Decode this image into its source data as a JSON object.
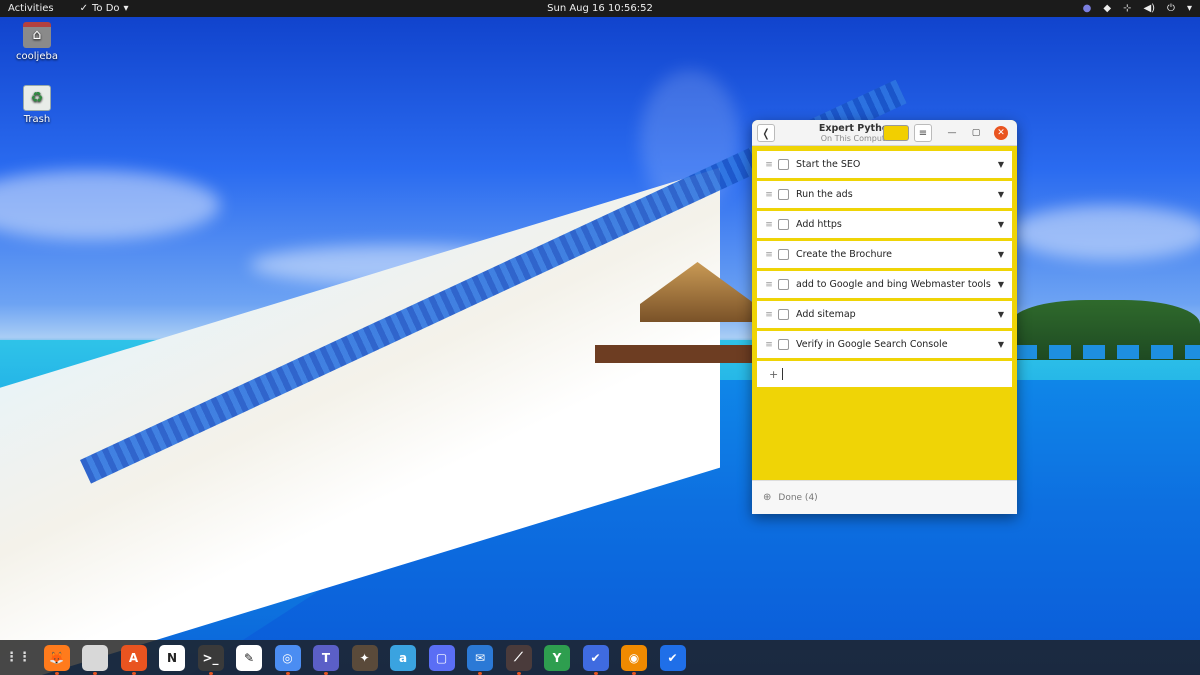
{
  "topbar": {
    "activities": "Activities",
    "app_name": "To Do",
    "clock": "Sun Aug 16  10:56:52"
  },
  "desktop": {
    "home_label": "cooljeba",
    "trash_label": "Trash"
  },
  "todo_window": {
    "title": "Expert Python",
    "subtitle": "On This Computer",
    "list_color": "#f2cf00",
    "background_color": "#efd406",
    "tasks": [
      {
        "label": "Start the SEO"
      },
      {
        "label": "Run the ads"
      },
      {
        "label": "Add https"
      },
      {
        "label": "Create the Brochure"
      },
      {
        "label": "add to Google and bing Webmaster tools"
      },
      {
        "label": "Add sitemap"
      },
      {
        "label": "Verify in Google Search Console"
      }
    ],
    "new_task_prefix": "+",
    "done_label": "Done (4)"
  },
  "dock": {
    "apps": [
      {
        "name": "apps-grid-icon",
        "glyph": "⋮⋮"
      },
      {
        "name": "firefox-icon",
        "glyph": "🦊",
        "color": "#ff7b1c"
      },
      {
        "name": "files-icon",
        "glyph": "",
        "color": "#d8d8d8"
      },
      {
        "name": "software-icon",
        "glyph": "A",
        "color": "#e95420"
      },
      {
        "name": "notion-icon",
        "glyph": "N",
        "color": "#ffffff"
      },
      {
        "name": "terminal-icon",
        "glyph": ">_",
        "color": "#3a3a3a"
      },
      {
        "name": "text-editor-icon",
        "glyph": "✎",
        "color": "#ffffff"
      },
      {
        "name": "chromium-icon",
        "glyph": "◎",
        "color": "#4b8df2"
      },
      {
        "name": "teams-icon",
        "glyph": "T",
        "color": "#5b5fc7"
      },
      {
        "name": "gimp-icon",
        "glyph": "✦",
        "color": "#5a4a3a"
      },
      {
        "name": "amazon-icon",
        "glyph": "a",
        "color": "#3aa3e0"
      },
      {
        "name": "screenshot-icon",
        "glyph": "▢",
        "color": "#5a6ef5"
      },
      {
        "name": "mail-icon",
        "glyph": "✉",
        "color": "#2b79d6"
      },
      {
        "name": "color-picker-icon",
        "glyph": "⟋",
        "color": "#4a3b3b"
      },
      {
        "name": "inkscape-icon",
        "glyph": "Y",
        "color": "#2e9e4f"
      },
      {
        "name": "todo-icon",
        "glyph": "✔",
        "color": "#3f6be0"
      },
      {
        "name": "podcast-icon",
        "glyph": "◉",
        "color": "#f08a00"
      },
      {
        "name": "tasks-icon",
        "glyph": "✔",
        "color": "#1f6fe8"
      }
    ]
  }
}
